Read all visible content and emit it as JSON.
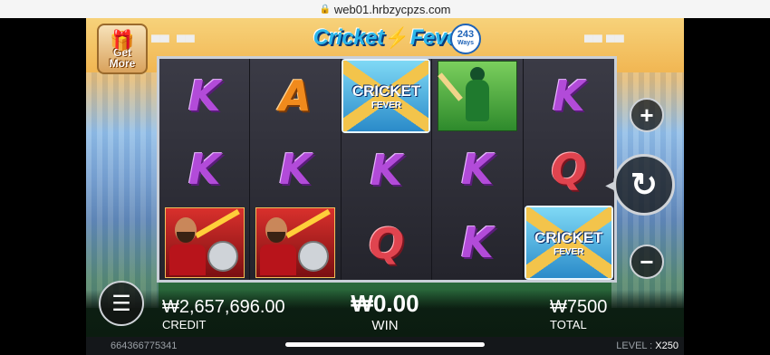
{
  "browser": {
    "url": "web01.hrbzycpzs.com"
  },
  "header": {
    "title_part1": "Cricket",
    "title_part2": "Fever",
    "ways_number": "243",
    "ways_label": "Ways",
    "get_more_line1": "Get",
    "get_more_line2": "More"
  },
  "reels": [
    [
      {
        "type": "letter",
        "value": "K",
        "color": "purple"
      },
      {
        "type": "letter",
        "value": "K",
        "color": "purple"
      },
      {
        "type": "player"
      }
    ],
    [
      {
        "type": "letter",
        "value": "A",
        "color": "orange"
      },
      {
        "type": "letter",
        "value": "K",
        "color": "purple"
      },
      {
        "type": "player"
      }
    ],
    [
      {
        "type": "wild",
        "line1": "CRICKET",
        "line2": "FEVER"
      },
      {
        "type": "letter",
        "value": "K",
        "color": "purple"
      },
      {
        "type": "letter",
        "value": "Q",
        "color": "red"
      }
    ],
    [
      {
        "type": "batter"
      },
      {
        "type": "letter",
        "value": "K",
        "color": "purple"
      },
      {
        "type": "letter",
        "value": "K",
        "color": "purple"
      }
    ],
    [
      {
        "type": "letter",
        "value": "K",
        "color": "purple"
      },
      {
        "type": "letter",
        "value": "Q",
        "color": "red"
      },
      {
        "type": "wild",
        "line1": "CRICKET",
        "line2": "FEVER"
      }
    ]
  ],
  "controls": {
    "plus": "+",
    "spin": "↻",
    "minus": "−",
    "menu": "☰"
  },
  "stats": {
    "credit_value": "₩2,657,696.00",
    "credit_label": "CREDIT",
    "win_value": "₩0.00",
    "win_label": "WIN",
    "total_value": "₩7500",
    "total_label": "TOTAL"
  },
  "footer": {
    "session_id": "664366775341",
    "level_label": "LEVEL :",
    "level_value": "X250"
  }
}
